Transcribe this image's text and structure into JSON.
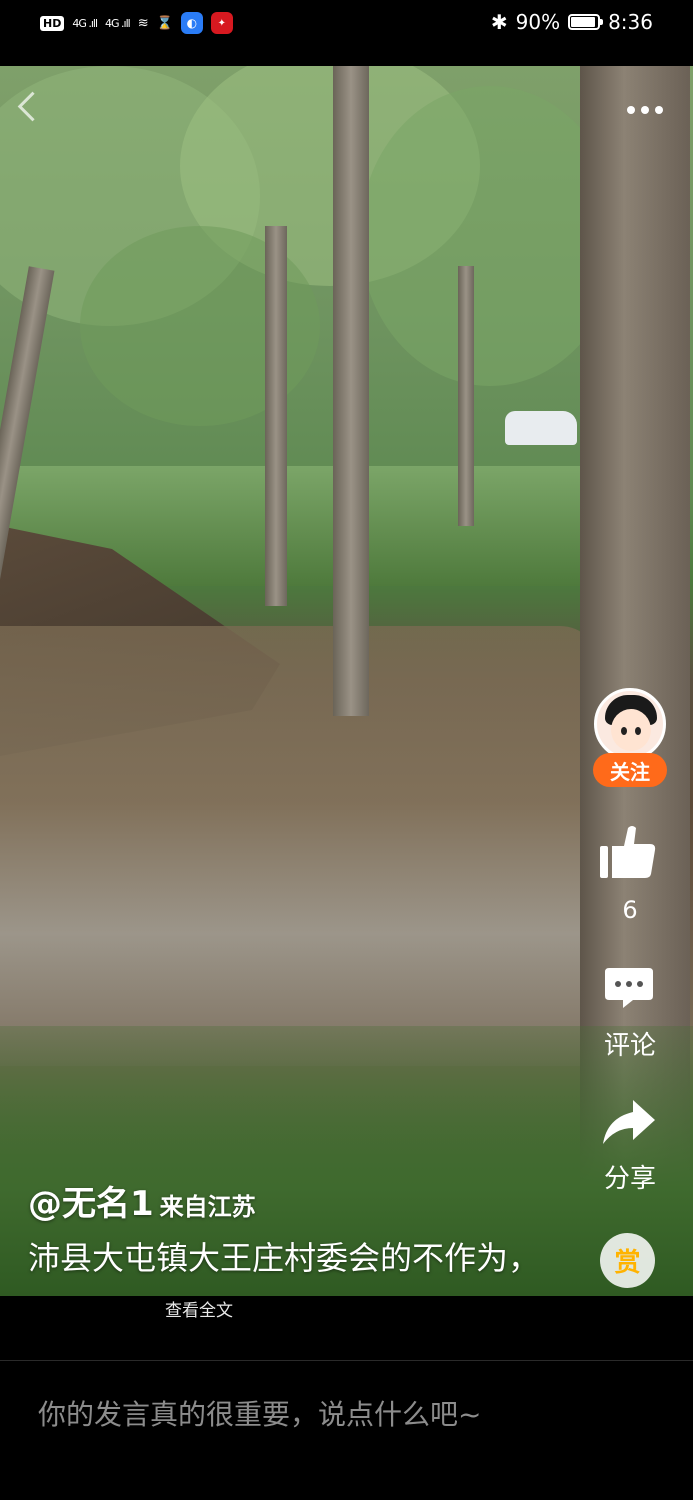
{
  "status_bar": {
    "hd_label": "HD",
    "signal_1": "4G .ıll",
    "signal_2": "4G .ıll",
    "wifi_glyph": "≋",
    "hourglass_glyph": "⌛",
    "battery_percent": "90%",
    "bluetooth_glyph": "✱",
    "time": "8:36",
    "battery_level": 0.9
  },
  "rail": {
    "follow_label": "关注",
    "like_count": "6",
    "comment_label": "评论",
    "share_label": "分享",
    "reward_label": "赏"
  },
  "post": {
    "author": "@无名1",
    "region": "来自江苏",
    "description": "沛县大屯镇大王庄村委会的不作为，",
    "read_more": "查看全文"
  },
  "comment_input": {
    "placeholder": "你的发言真的很重要，说点什么吧~"
  },
  "colors": {
    "follow_button": "#ff6a1a",
    "reward_glyph": "#ffb300",
    "placeholder_text": "#8c8c8c"
  },
  "icons": [
    "back-icon",
    "more-icon",
    "like-icon",
    "comment-icon",
    "share-icon",
    "reward-icon",
    "battery-icon",
    "bluetooth-icon",
    "wifi-icon"
  ]
}
